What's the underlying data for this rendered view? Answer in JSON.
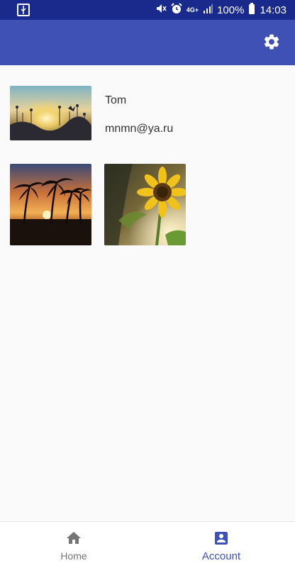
{
  "status_bar": {
    "battery": "100%",
    "network": "4G+",
    "time": "14:03"
  },
  "app_bar": {
    "settings_icon": "gear-icon"
  },
  "profile": {
    "name": "Tom",
    "email": "mnmn@ya.ru"
  },
  "bottom_nav": {
    "items": [
      {
        "label": "Home",
        "icon": "home-icon",
        "active": false
      },
      {
        "label": "Account",
        "icon": "account-box-icon",
        "active": true
      }
    ]
  },
  "colors": {
    "status_bar": "#1a2a8c",
    "primary": "#3f51b5",
    "inactive": "#757575"
  }
}
